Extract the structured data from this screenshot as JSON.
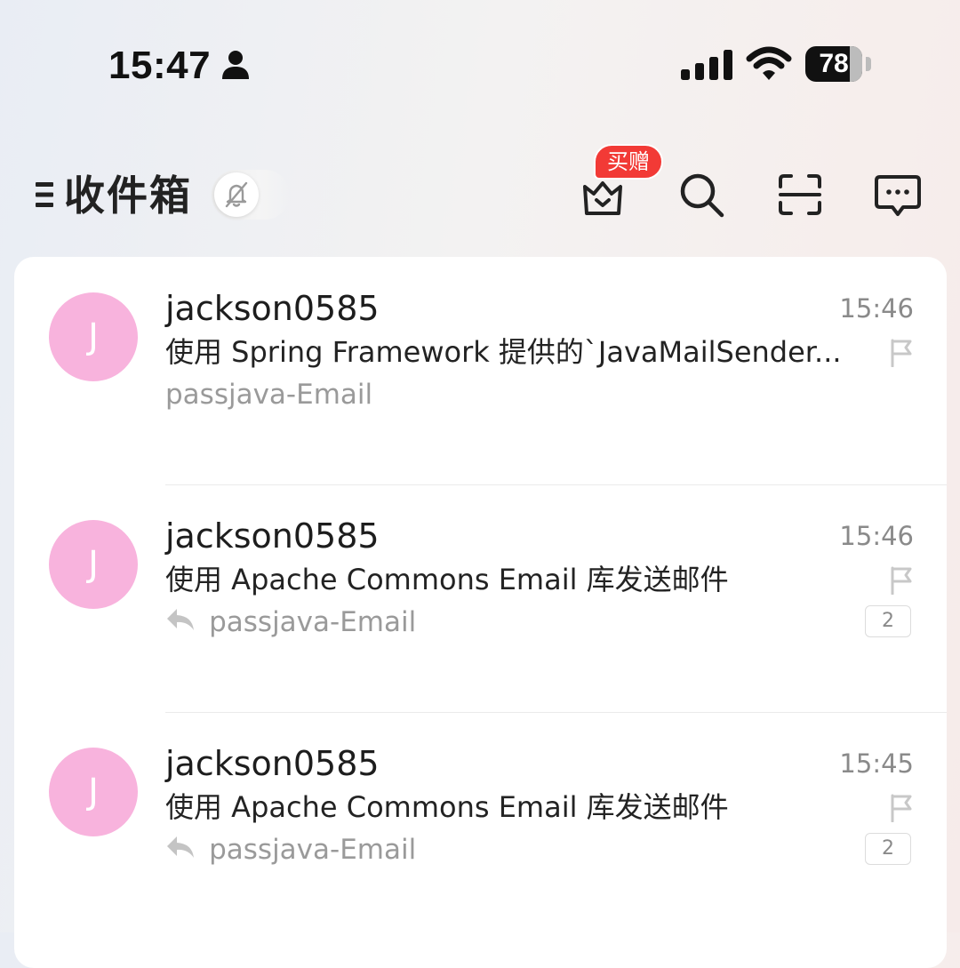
{
  "status_bar": {
    "time": "15:47",
    "battery_level": "78",
    "battery_fraction": 0.78,
    "icons": [
      "person-icon",
      "cellular-signal-icon",
      "wifi-icon",
      "battery-icon"
    ]
  },
  "header": {
    "title": "收件箱",
    "promo_badge": "买赠",
    "icons": [
      "menu-icon",
      "bell-off-icon",
      "vip-crown-icon",
      "search-icon",
      "scan-icon",
      "chat-icon"
    ]
  },
  "mails": [
    {
      "avatar_initial": "J",
      "sender": "jackson0585",
      "time": "15:46",
      "subject": "使用 Spring Framework 提供的`JavaMailSender...",
      "preview": "passjava-Email",
      "replied": false,
      "thread_count": ""
    },
    {
      "avatar_initial": "J",
      "sender": "jackson0585",
      "time": "15:46",
      "subject": "使用 Apache Commons Email 库发送邮件",
      "preview": "passjava-Email",
      "replied": true,
      "thread_count": "2"
    },
    {
      "avatar_initial": "J",
      "sender": "jackson0585",
      "time": "15:45",
      "subject": "使用 Apache Commons Email 库发送邮件",
      "preview": "passjava-Email",
      "replied": true,
      "thread_count": "2"
    }
  ],
  "colors": {
    "avatar": "#f8b3dd",
    "promo_badge": "#f23a36",
    "flag": "#c8c8c8"
  }
}
